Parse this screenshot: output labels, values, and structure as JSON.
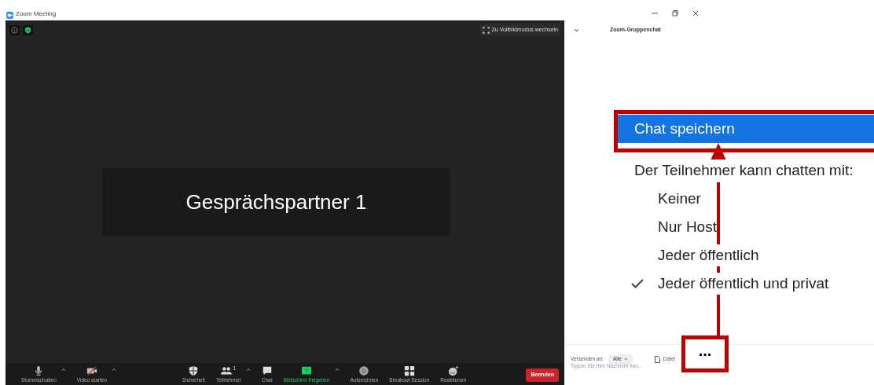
{
  "window": {
    "title": "Zoom Meeting"
  },
  "video": {
    "fullscreen_button": "Zu Vollbildmodus wechseln",
    "participant_name": "Gesprächspartner 1"
  },
  "toolbar": [
    {
      "label": "Stummschalten",
      "caret": true,
      "highlighted": false
    },
    {
      "label": "Video starten",
      "caret": true,
      "highlighted": false
    },
    {
      "label": "Sicherheit",
      "caret": false,
      "highlighted": false
    },
    {
      "label": "Teilnehmer",
      "count": "1",
      "caret": true,
      "highlighted": false
    },
    {
      "label": "Chat",
      "caret": false,
      "highlighted": false
    },
    {
      "label": "Bildschirm freigeben",
      "caret": true,
      "highlighted": true
    },
    {
      "label": "Aufzeichnen",
      "caret": false,
      "highlighted": false
    },
    {
      "label": "Breakout Session",
      "caret": false,
      "highlighted": false
    },
    {
      "label": "Reaktionen",
      "caret": false,
      "highlighted": false
    }
  ],
  "end_button": "Beenden",
  "chat": {
    "title": "Zoom-Gruppenchat",
    "send_to_label": "Versenden an:",
    "recipient": "Alle",
    "file_button": "Datei",
    "more_button": "...",
    "placeholder": "Tippen Sie Ihre Nachricht hier..."
  },
  "menu": [
    {
      "kind": "action",
      "label": "Chat speichern",
      "selected": true
    },
    {
      "kind": "heading",
      "label": "Der Teilnehmer kann chatten mit:"
    },
    {
      "kind": "option",
      "label": "Keiner",
      "checked": false
    },
    {
      "kind": "option",
      "label": "Nur Host",
      "checked": false
    },
    {
      "kind": "option",
      "label": "Jeder öffentlich",
      "checked": false
    },
    {
      "kind": "option",
      "label": "Jeder öffentlich und privat",
      "checked": true
    }
  ]
}
